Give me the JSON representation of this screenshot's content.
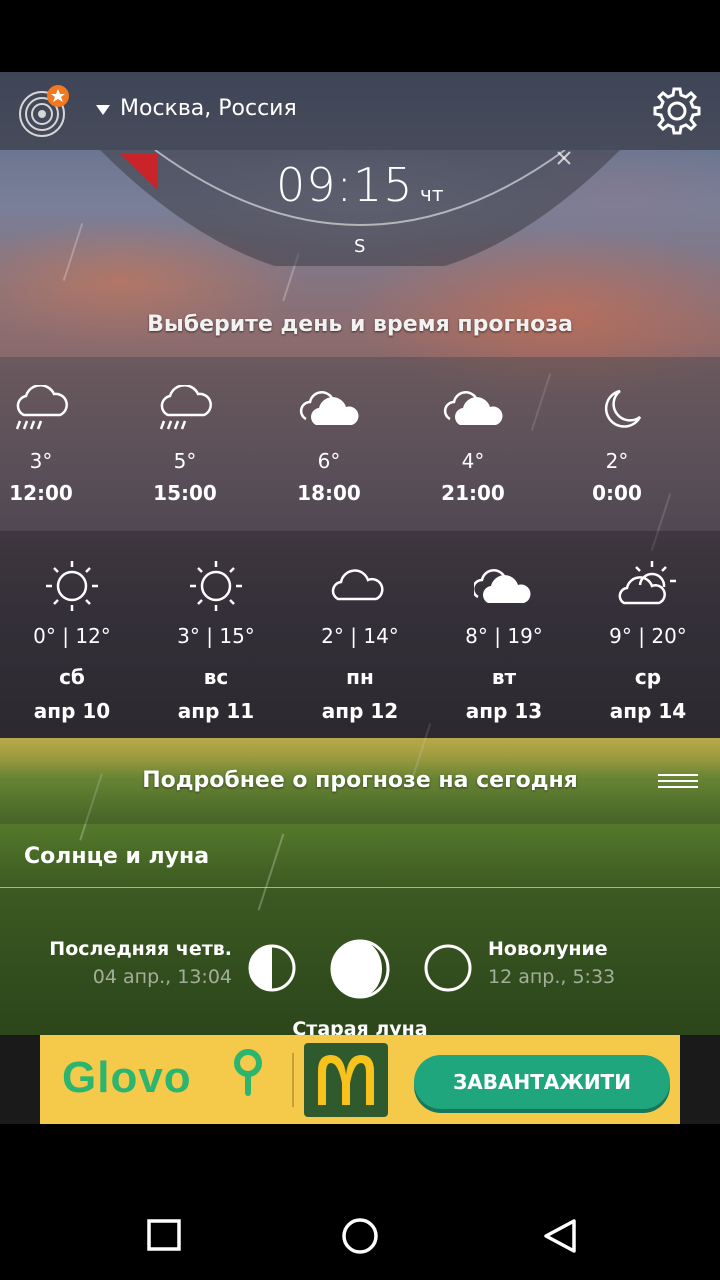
{
  "location": "Москва, Россия",
  "clock": {
    "time": "09:15",
    "day": "чт",
    "direction": "S"
  },
  "prompt": "Выберите день и время прогноза",
  "hourly": [
    {
      "icon": "rain-icon",
      "temp": "3°",
      "time": "12:00"
    },
    {
      "icon": "rain-icon",
      "temp": "5°",
      "time": "15:00"
    },
    {
      "icon": "cloudy-icon",
      "temp": "6°",
      "time": "18:00"
    },
    {
      "icon": "cloudy-icon",
      "temp": "4°",
      "time": "21:00"
    },
    {
      "icon": "moon-icon",
      "temp": "2°",
      "time": "0:00"
    }
  ],
  "daily": [
    {
      "icon": "sun-icon",
      "range": "0° | 12°",
      "weekday": "сб",
      "date": "апр 10"
    },
    {
      "icon": "sun-icon",
      "range": "3° | 15°",
      "weekday": "вс",
      "date": "апр 11"
    },
    {
      "icon": "cloud-icon",
      "range": "2° | 14°",
      "weekday": "пн",
      "date": "апр 12"
    },
    {
      "icon": "cloudy-icon",
      "range": "8° | 19°",
      "weekday": "вт",
      "date": "апр 13"
    },
    {
      "icon": "partly-cloudy-icon",
      "range": "9° | 20°",
      "weekday": "ср",
      "date": "апр 14"
    }
  ],
  "detail_title": "Подробнее о прогнозе на сегодня",
  "sun_moon_title": "Солнце и луна",
  "moon": {
    "left_name": "Последняя четв.",
    "left_date": "04 апр., 13:04",
    "right_name": "Новолуние",
    "right_date": "12 апр., 5:33",
    "center_name": "Старая луна"
  },
  "ad": {
    "brand": "Glovo",
    "button": "ЗАВАНТАЖИТИ"
  },
  "colors": {
    "ad_bg": "#f5c94a",
    "ad_button": "#1fa67d",
    "glovo_green": "#2bb56f"
  }
}
